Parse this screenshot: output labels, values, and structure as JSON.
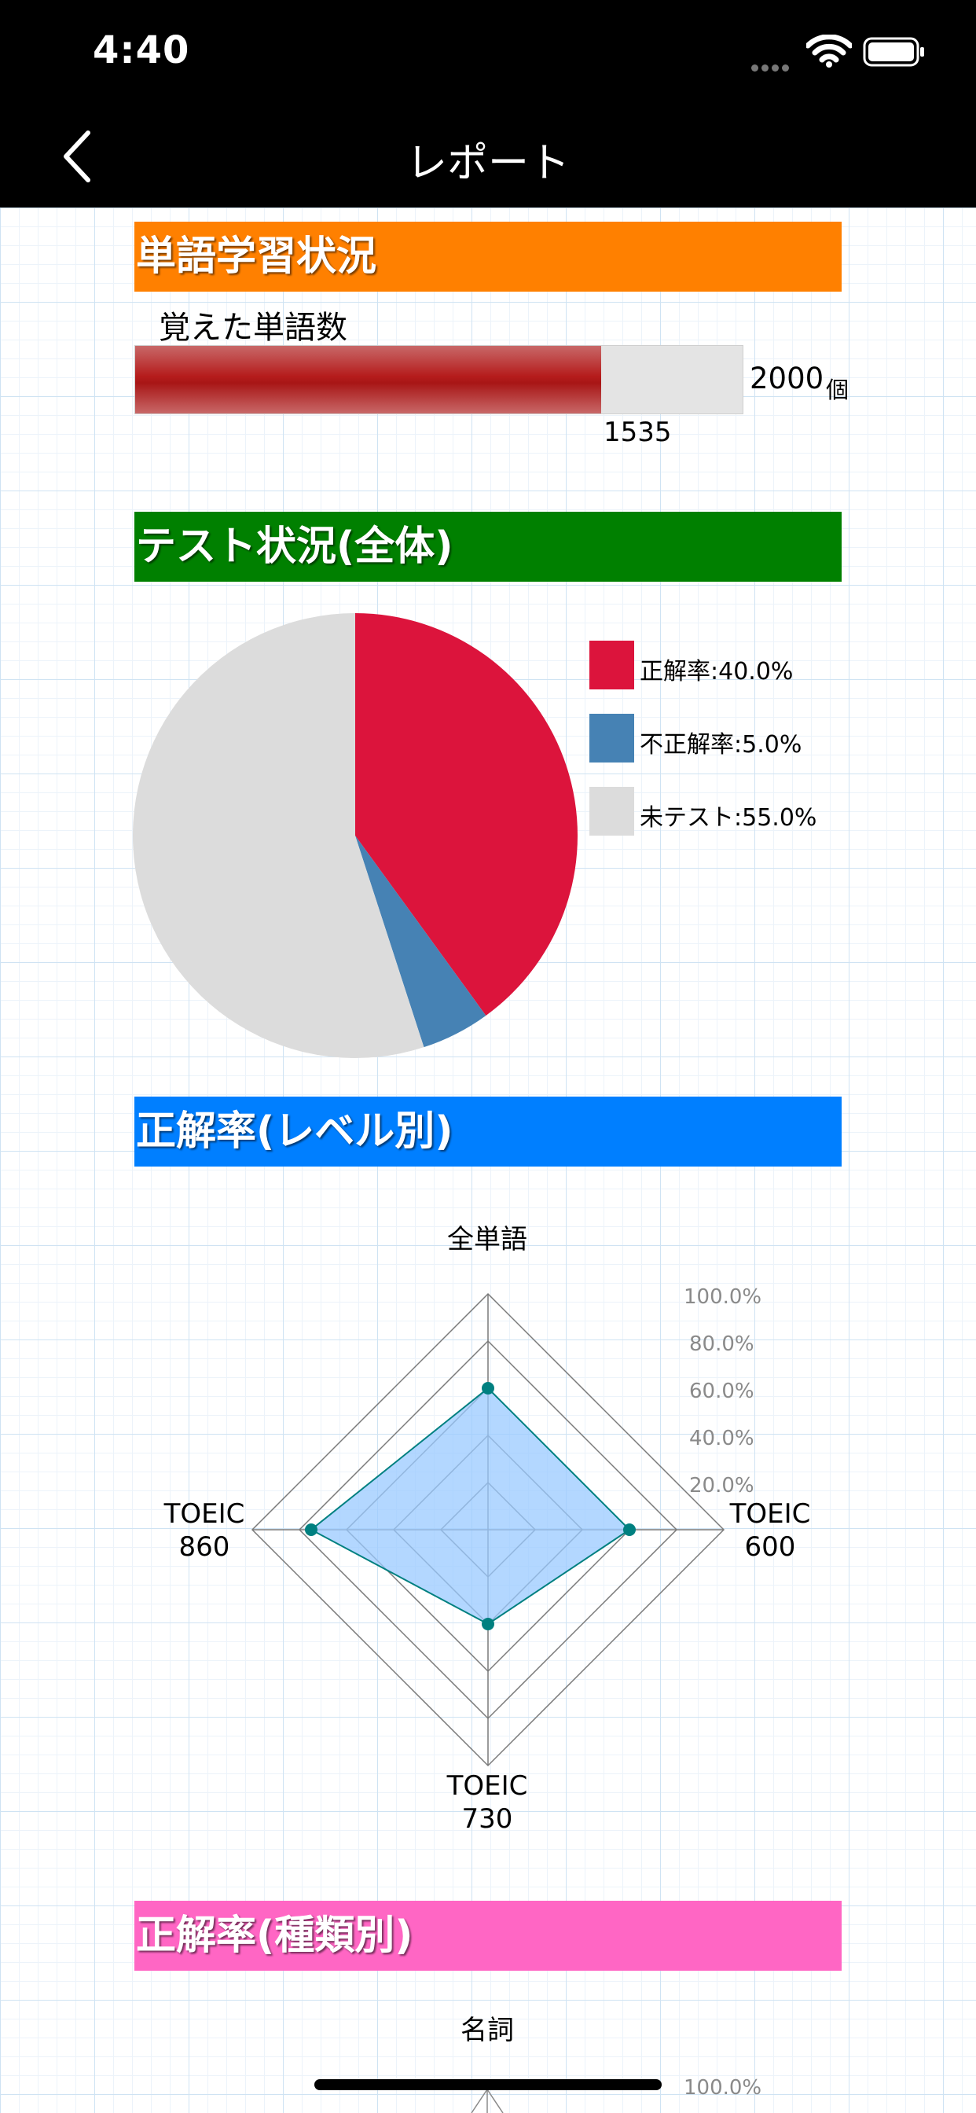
{
  "status_bar": {
    "time": "4:40"
  },
  "nav": {
    "title": "レポート"
  },
  "vocab": {
    "header": "単語学習状況",
    "label": "覚えた単語数",
    "value": "1535",
    "total": "2000",
    "unit": "個",
    "progress_fraction": 0.7675
  },
  "test": {
    "header": "テスト状況(全体)",
    "legend": [
      "正解率:40.0%",
      "不正解率:5.0%",
      "未テスト:55.0%"
    ]
  },
  "level": {
    "header": "正解率(レベル別)",
    "axes": {
      "top": "全単語",
      "right": "TOEIC\n600",
      "bottom": "TOEIC\n730",
      "left": "TOEIC\n860"
    },
    "ticks": [
      "100.0%",
      "80.0%",
      "60.0%",
      "40.0%",
      "20.0%"
    ]
  },
  "kind": {
    "header": "正解率(種類別)",
    "axes": {
      "top": "名詞"
    },
    "ticks": [
      "100.0%"
    ]
  },
  "colors": {
    "orange": "#ff8000",
    "green": "#008000",
    "blue": "#007fff",
    "pink": "#ff66c4",
    "correct": "#dc143c",
    "incorrect": "#4682b4",
    "untested": "#dcdcdc",
    "radar_fill": "#99c9ff",
    "radar_point": "#008080"
  },
  "chart_data": [
    {
      "type": "pie",
      "labels": [
        "正解率:40.0%",
        "不正解率:5.0%",
        "未テスト:55.0%"
      ],
      "values": [
        40.0,
        5.0,
        55.0
      ],
      "colors": [
        "#dc143c",
        "#4682b4",
        "#dcdcdc"
      ],
      "legend": "right"
    },
    {
      "type": "radar",
      "categories": [
        "全単語",
        "TOEIC 600",
        "TOEIC 730",
        "TOEIC 860"
      ],
      "values": [
        60,
        60,
        40,
        75
      ],
      "range": [
        0,
        100
      ],
      "ticks": [
        "20.0%",
        "40.0%",
        "60.0%",
        "80.0%",
        "100.0%"
      ]
    }
  ]
}
